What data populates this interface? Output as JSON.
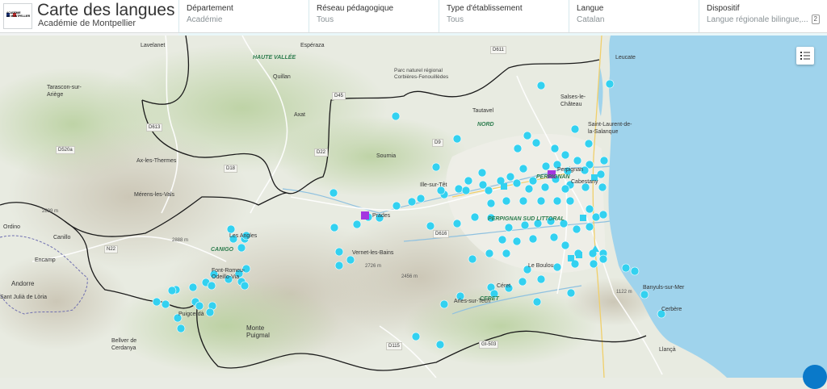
{
  "header": {
    "title": "Carte des langues",
    "subtitle": "Académie de Montpellier",
    "logo_text": [
      "ACADÉMIE",
      "DE MONTPELLIER"
    ],
    "filters": [
      {
        "label": "Département",
        "value": "Académie"
      },
      {
        "label": "Réseau pédagogique",
        "value": "Tous"
      },
      {
        "label": "Type d'établissement",
        "value": "Tous"
      },
      {
        "label": "Langue",
        "value": "Catalan"
      },
      {
        "label": "Dispositif",
        "value": "Langue régionale bilingue,...",
        "count": "2"
      }
    ]
  },
  "colors": {
    "header_bg": "#ffffff",
    "filter_bar": "#e9f7f9",
    "marker": "#33d1f0",
    "marker_highlight": "#a436e0",
    "sea": "#9fd3ec",
    "land": "#e9ece4",
    "border": "#1a1a1a"
  },
  "map": {
    "labels": [
      {
        "text": "Lavelanet",
        "kind": "place"
      },
      {
        "text": "Espéraza",
        "kind": "place"
      },
      {
        "text": "HAUTE VALLÉE",
        "kind": "region"
      },
      {
        "text": "Quillan",
        "kind": "place"
      },
      {
        "text": "Parc naturel régional Corbières-Fenouillèdes",
        "kind": "place"
      },
      {
        "text": "Tarascon-sur-Ariège",
        "kind": "place"
      },
      {
        "text": "Axat",
        "kind": "place"
      },
      {
        "text": "Tautavel",
        "kind": "place"
      },
      {
        "text": "Salses-le-Château",
        "kind": "place"
      },
      {
        "text": "Leucate",
        "kind": "place"
      },
      {
        "text": "Saint-Laurent-de-la-Salanque",
        "kind": "place"
      },
      {
        "text": "NORD",
        "kind": "region"
      },
      {
        "text": "Sournia",
        "kind": "place"
      },
      {
        "text": "Ax-les-Thermes",
        "kind": "place"
      },
      {
        "text": "PERPIGNAN",
        "kind": "region"
      },
      {
        "text": "Perpignan",
        "kind": "place"
      },
      {
        "text": "Cabestany",
        "kind": "place"
      },
      {
        "text": "Ille-sur-Têt",
        "kind": "place"
      },
      {
        "text": "Mérens-les-Vals",
        "kind": "place"
      },
      {
        "text": "PERPIGNAN SUD LITTORAL",
        "kind": "region"
      },
      {
        "text": "Prades",
        "kind": "place"
      },
      {
        "text": "Les Angles",
        "kind": "place"
      },
      {
        "text": "Vernet-les-Bains",
        "kind": "place"
      },
      {
        "text": "CANIGO",
        "kind": "region"
      },
      {
        "text": "Ordino",
        "kind": "place"
      },
      {
        "text": "Canillo",
        "kind": "place"
      },
      {
        "text": "Encamp",
        "kind": "place"
      },
      {
        "text": "Andorre",
        "kind": "place"
      },
      {
        "text": "Font-Romeu-Odeillo-Via",
        "kind": "place"
      },
      {
        "text": "Le Boulou",
        "kind": "place"
      },
      {
        "text": "Céret",
        "kind": "place"
      },
      {
        "text": "CERET",
        "kind": "region"
      },
      {
        "text": "Arles-sur-Tech",
        "kind": "place"
      },
      {
        "text": "Banyuls-sur-Mer",
        "kind": "place"
      },
      {
        "text": "Cerbère",
        "kind": "place"
      },
      {
        "text": "Sant Julià de Lòria",
        "kind": "place"
      },
      {
        "text": "Puigcerdà",
        "kind": "place"
      },
      {
        "text": "Monte Puigmal",
        "kind": "place"
      },
      {
        "text": "Bellver de Cerdanya",
        "kind": "place"
      },
      {
        "text": "Llançà",
        "kind": "place"
      },
      {
        "text": "D611",
        "kind": "road"
      },
      {
        "text": "D613",
        "kind": "road"
      },
      {
        "text": "D45",
        "kind": "road"
      },
      {
        "text": "D22",
        "kind": "road"
      },
      {
        "text": "D9",
        "kind": "road"
      },
      {
        "text": "D18",
        "kind": "road"
      },
      {
        "text": "D520a",
        "kind": "road"
      },
      {
        "text": "D616",
        "kind": "road"
      },
      {
        "text": "N22",
        "kind": "road"
      },
      {
        "text": "D115",
        "kind": "road"
      },
      {
        "text": "GI-503",
        "kind": "road"
      },
      {
        "text": "2888 m",
        "kind": "elev"
      },
      {
        "text": "2899 m",
        "kind": "elev"
      },
      {
        "text": "2726 m",
        "kind": "elev"
      },
      {
        "text": "2456 m",
        "kind": "elev"
      },
      {
        "text": "1122 m",
        "kind": "elev"
      }
    ]
  }
}
